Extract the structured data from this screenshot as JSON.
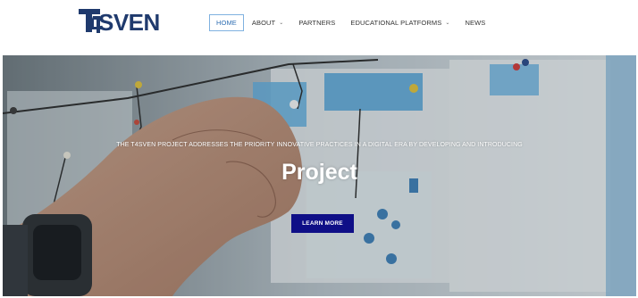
{
  "brand": {
    "logo_text": "SVEN",
    "logo_mark": "T4",
    "colors": {
      "navy": "#1f3a6d",
      "accent_blue": "#2f6fb3"
    }
  },
  "nav": {
    "items": [
      {
        "label": "HOME",
        "active": true,
        "dropdown": false
      },
      {
        "label": "ABOUT",
        "active": false,
        "dropdown": true
      },
      {
        "label": "PARTNERS",
        "active": false,
        "dropdown": false
      },
      {
        "label": "EDUCATIONAL PLATFORMS",
        "active": false,
        "dropdown": true
      },
      {
        "label": "NEWS",
        "active": false,
        "dropdown": false
      }
    ],
    "dropdown_icon": "chevron-down-icon"
  },
  "hero": {
    "subtitle": "THE T4SVEN PROJECT ADDRESSES THE PRIORITY INNOVATIVE PRACTICES IN A DIGITAL ERA BY DEVELOPING AND INTRODUCING",
    "title": "Project",
    "button_label": "LEARN MORE",
    "button_color": "#0f0f87",
    "background_image": "hand pinning wires on a whiteboard with maps and notes"
  }
}
